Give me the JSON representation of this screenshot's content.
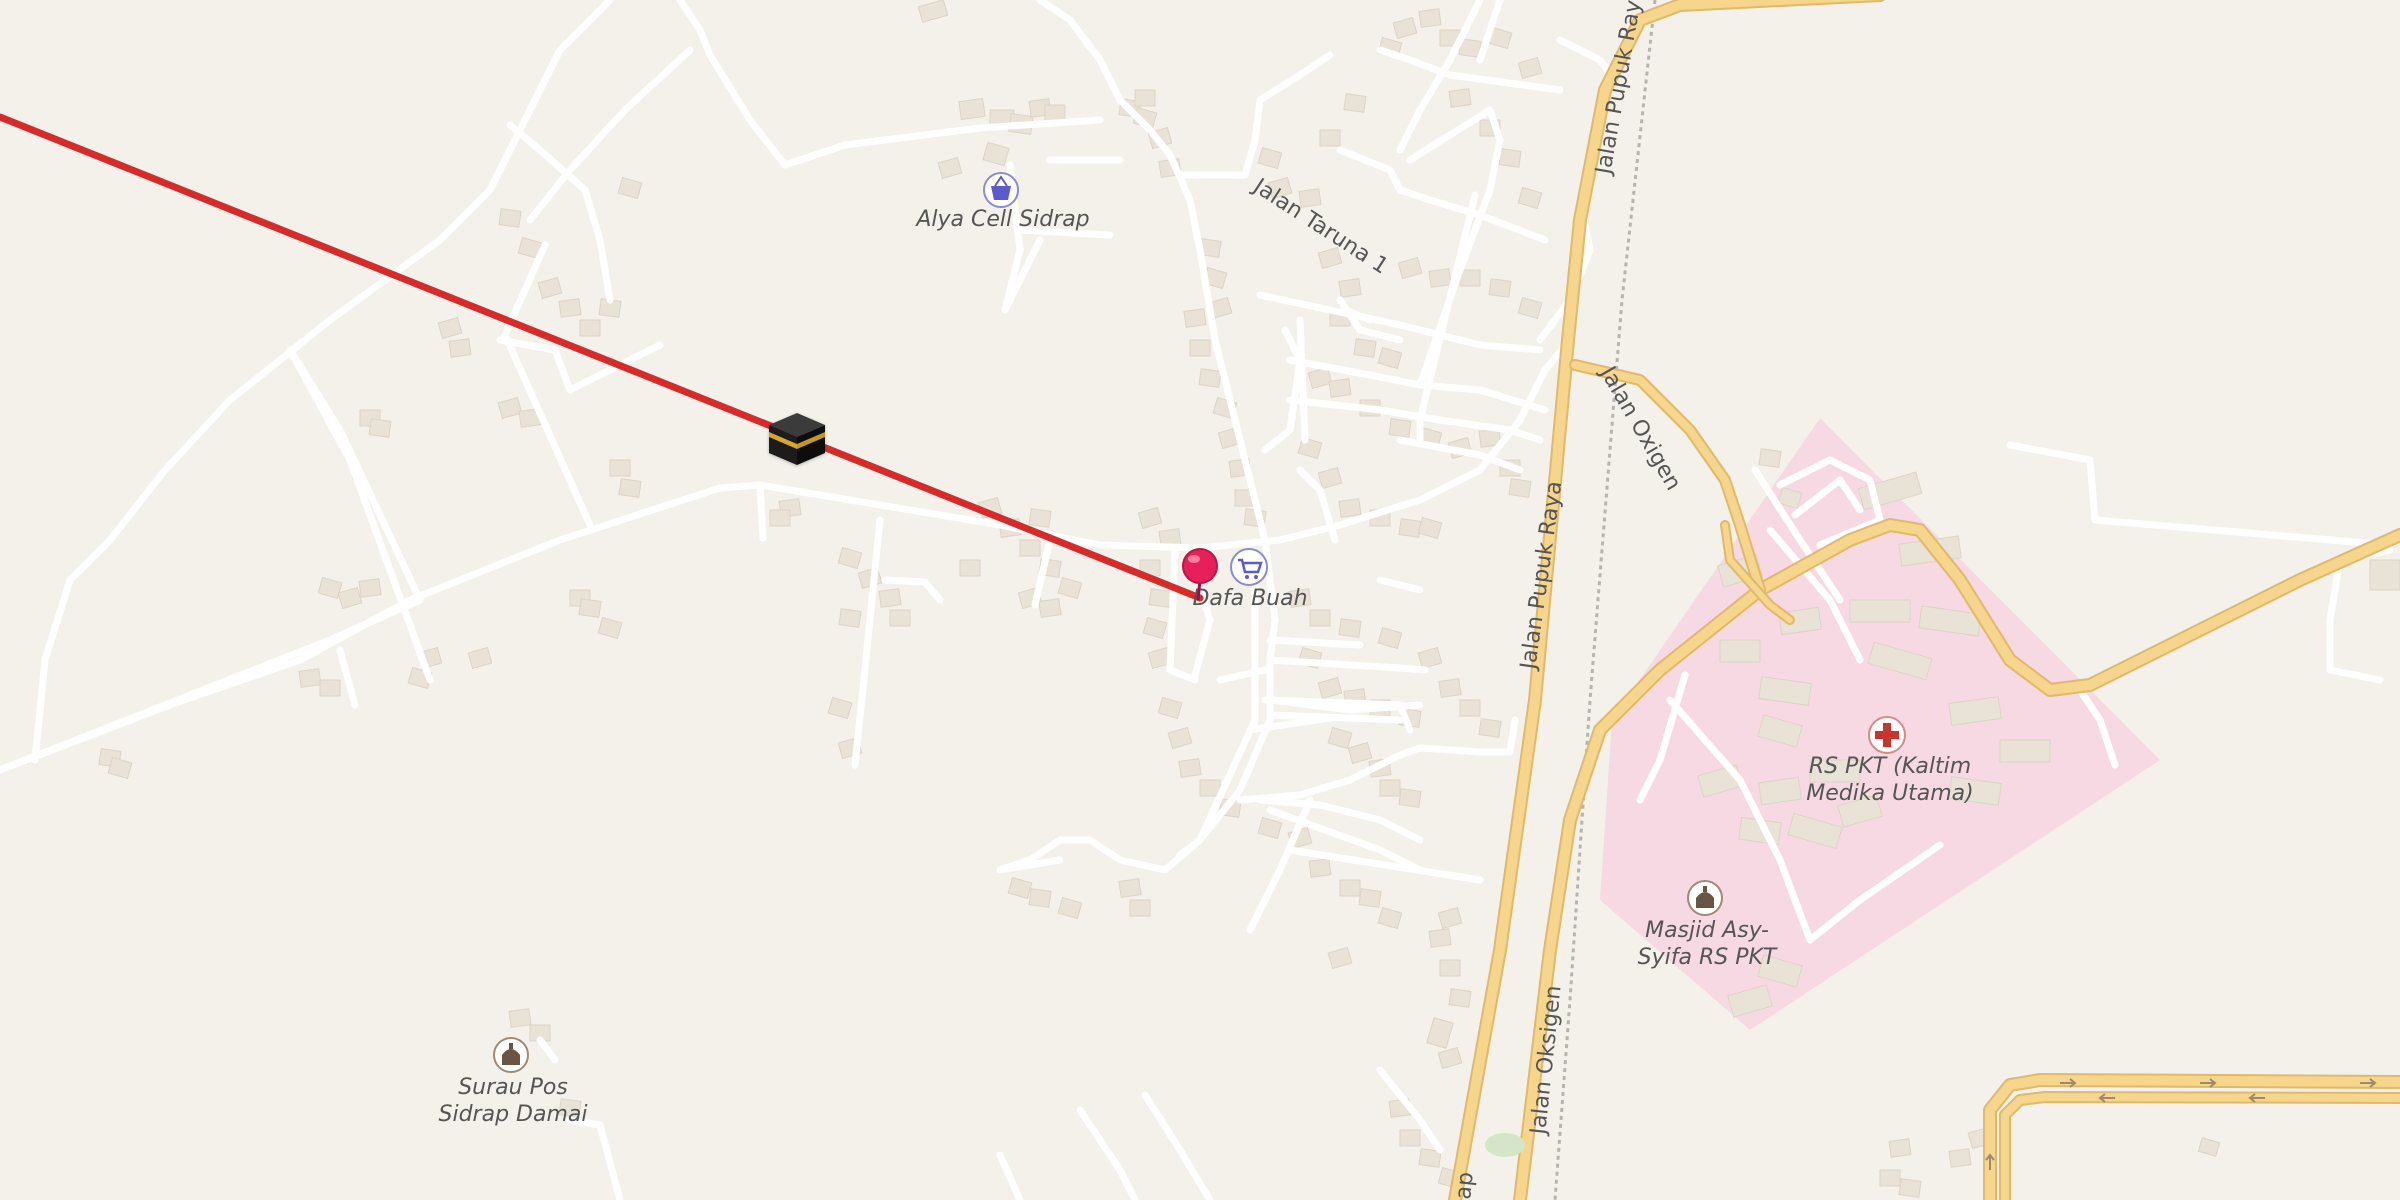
{
  "map": {
    "background_color": "#f3f1ea",
    "road_color": "#ffffff",
    "major_road_color": "#f6d58c",
    "hospital_area_color": "#f7d9e3",
    "building_color": "#e9e2d6",
    "qibla_line_color": "#d62b2b",
    "pin_color": "#e8205a"
  },
  "streets": {
    "jalan_pupuk_raya_north": "Jalan Pupuk Raya",
    "jalan_pupuk_raya_south": "Jalan Pupuk Raya",
    "jalan_taruna_1": "Jalan Taruna 1",
    "jalan_oxigen": "Jalan Oxigen",
    "jalan_oksigen": "Jalan Oksigen",
    "partial_bottom": "ap"
  },
  "pois": {
    "alya_cell": {
      "name": "Alya Cell Sidrap",
      "icon": "shopping-basket-icon"
    },
    "dafa_buah": {
      "name": "Dafa Buah",
      "icon": "shopping-cart-icon"
    },
    "rs_pkt": {
      "name_line1": "RS PKT (Kaltim",
      "name_line2": "Medika Utama)",
      "icon": "hospital-cross-icon"
    },
    "masjid_asy_syifa": {
      "name_line1": "Masjid Asy-",
      "name_line2": "Syifa RS PKT",
      "icon": "mosque-icon"
    },
    "surau_pos": {
      "name_line1": "Surau Pos",
      "name_line2": "Sidrap Damai",
      "icon": "mosque-icon"
    }
  },
  "markers": {
    "kaaba": {
      "icon": "kaaba-icon"
    },
    "location_pin": {
      "icon": "location-pin-icon"
    }
  }
}
